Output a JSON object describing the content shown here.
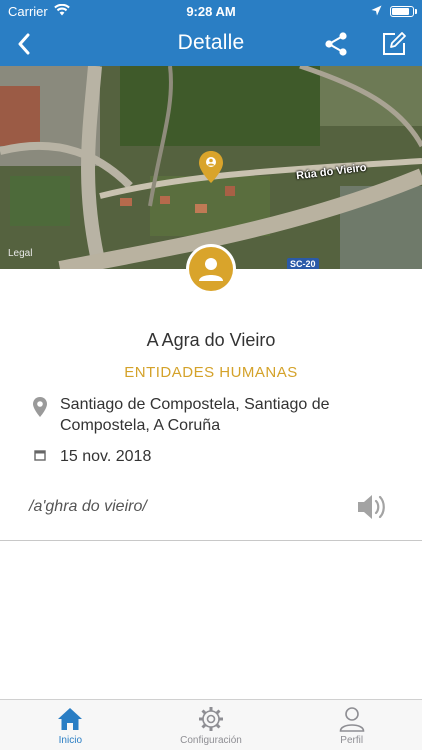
{
  "status": {
    "carrier": "Carrier",
    "time": "9:28 AM",
    "battery_level": 0.92
  },
  "nav": {
    "title": "Detalle",
    "icons": [
      "back-chevron-icon",
      "share-icon",
      "edit-icon"
    ]
  },
  "map": {
    "street_label": "Rúa do Vieiro",
    "road_badge": "SC-20",
    "legal": "Legal"
  },
  "place": {
    "name": "A Agra do Vieiro",
    "category": "ENTIDADES HUMANAS",
    "location": "Santiago de Compostela, Santiago de Compostela, A Coruña",
    "date": "15 nov. 2018",
    "phonetic": "/a'ghra do vieiro/"
  },
  "tabs": [
    {
      "label": "Inicio",
      "icon": "home-icon",
      "active": true
    },
    {
      "label": "Configuración",
      "icon": "gear-icon",
      "active": false
    },
    {
      "label": "Perfil",
      "icon": "user-icon",
      "active": false
    }
  ],
  "colors": {
    "primary": "#2a7ec4",
    "accent": "#d4a22a",
    "text": "#333333",
    "inactive": "#8e8e93"
  }
}
